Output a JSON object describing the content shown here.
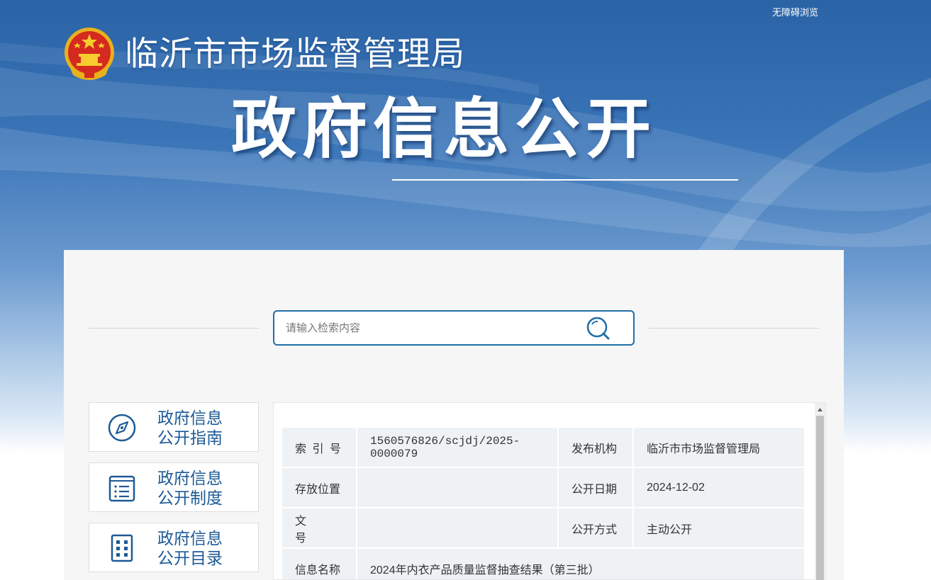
{
  "header": {
    "accessibility_label": "无障碍浏览",
    "emblem_icon": "national-emblem-icon",
    "site_title": "临沂市市场监督管理局",
    "hero_title": "政府信息公开"
  },
  "search": {
    "placeholder": "请输入检索内容",
    "icon": "search-icon",
    "accent_color": "#1e6fa7"
  },
  "nav": {
    "items": [
      {
        "line1": "政府信息",
        "line2": "公开指南",
        "icon": "compass-icon"
      },
      {
        "line1": "政府信息",
        "line2": "公开制度",
        "icon": "document-list-icon"
      },
      {
        "line1": "政府信息",
        "line2": "公开目录",
        "icon": "catalog-grid-icon"
      }
    ]
  },
  "info": {
    "index_label": "索 引 号",
    "index_value": "1560576826/scjdj/2025-0000079",
    "publisher_label": "发布机构",
    "publisher_value": "临沂市市场监督管理局",
    "location_label": "存放位置",
    "location_value": "",
    "date_label": "公开日期",
    "date_value": "2024-12-02",
    "docno_label": "文　　号",
    "docno_value": "",
    "method_label": "公开方式",
    "method_value": "主动公开",
    "name_label": "信息名称",
    "name_value": "2024年内衣产品质量监督抽查结果（第三批）"
  }
}
